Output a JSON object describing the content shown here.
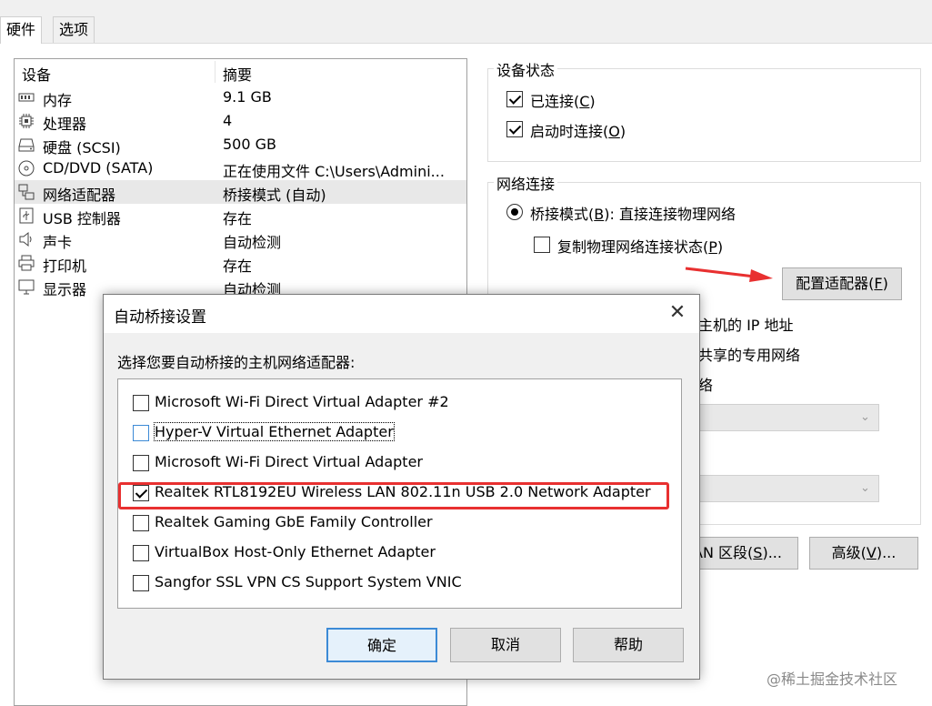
{
  "tabs": [
    {
      "label": "硬件"
    },
    {
      "label": "选项"
    }
  ],
  "devices": {
    "header": {
      "col_device": "设备",
      "col_summary": "摘要"
    },
    "rows": [
      {
        "icon": "memory-icon",
        "name": "内存",
        "summary": "9.1 GB"
      },
      {
        "icon": "cpu-icon",
        "name": "处理器",
        "summary": "4"
      },
      {
        "icon": "harddisk-icon",
        "name": "硬盘 (SCSI)",
        "summary": "500 GB"
      },
      {
        "icon": "cd-dvd-icon",
        "name": "CD/DVD (SATA)",
        "summary": "正在使用文件 C:\\Users\\Admini..."
      },
      {
        "icon": "network-adapter-icon",
        "name": "网络适配器",
        "summary": "桥接模式 (自动)",
        "selected": true
      },
      {
        "icon": "usb-icon",
        "name": "USB 控制器",
        "summary": "存在"
      },
      {
        "icon": "speaker-icon",
        "name": "声卡",
        "summary": "自动检测"
      },
      {
        "icon": "printer-icon",
        "name": "打印机",
        "summary": "存在"
      },
      {
        "icon": "display-icon",
        "name": "显示器",
        "summary": "自动检测"
      }
    ]
  },
  "device_status": {
    "title": "设备状态",
    "connected": {
      "label": "已连接(",
      "key": "C",
      "close": ")",
      "checked": true
    },
    "connect_at_power_on": {
      "label": "启动时连接(",
      "key": "O",
      "close": ")",
      "checked": true
    }
  },
  "network_connection": {
    "title": "网络连接",
    "bridged": {
      "label": "桥接模式(",
      "key": "B",
      "close": "): 直接连接物理网络",
      "checked": true
    },
    "replicate": {
      "label": "复制物理网络连接状态(",
      "key": "P",
      "close": ")",
      "checked": false
    },
    "configure_button": {
      "label": "配置适配器(",
      "key": "F",
      "close": ")"
    },
    "partial_nat": "主机的 IP 地址",
    "partial_host_only": "共享的专用网络",
    "partial_custom": "络",
    "lan_segments_button": {
      "label": "AN 区段(",
      "key": "S",
      "close": ")..."
    },
    "advanced_button": {
      "label": "高级(",
      "key": "V",
      "close": ")..."
    }
  },
  "dialog": {
    "title": "自动桥接设置",
    "prompt": "选择您要自动桥接的主机网络适配器:",
    "adapters": [
      {
        "label": "Microsoft Wi-Fi Direct Virtual Adapter #2",
        "checked": false
      },
      {
        "label": "Hyper-V Virtual Ethernet Adapter",
        "checked": false
      },
      {
        "label": "Microsoft Wi-Fi Direct Virtual Adapter",
        "checked": false
      },
      {
        "label": "Realtek RTL8192EU Wireless LAN 802.11n USB 2.0 Network Adapter",
        "checked": true
      },
      {
        "label": "Realtek Gaming GbE Family Controller",
        "checked": false
      },
      {
        "label": "VirtualBox Host-Only Ethernet Adapter",
        "checked": false
      },
      {
        "label": "Sangfor SSL VPN CS Support System VNIC",
        "checked": false
      }
    ],
    "ok_label": "确定",
    "cancel_label": "取消",
    "help_label": "帮助"
  },
  "colors": {
    "highlight": "#e83030",
    "arrow": "#e83030",
    "primary_border": "#3c8ad6"
  },
  "watermark": "@稀土掘金技术社区"
}
